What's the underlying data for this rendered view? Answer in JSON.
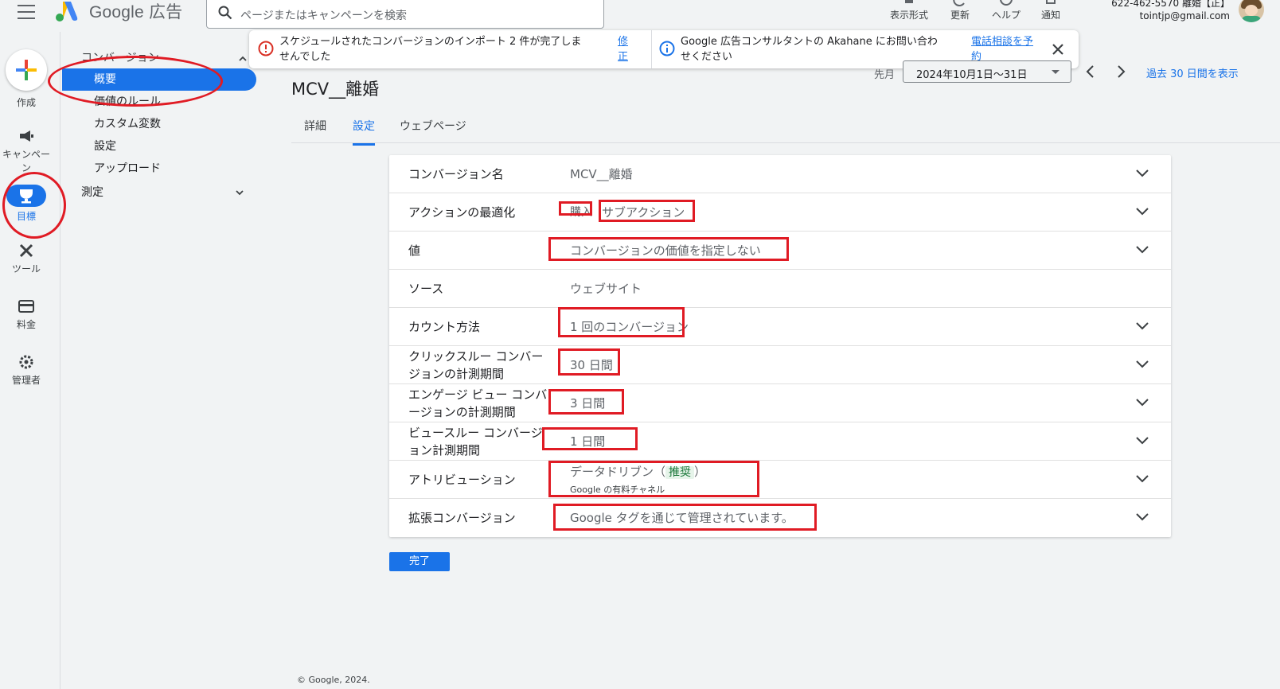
{
  "app": {
    "logo_text": "Google 広告",
    "search_placeholder": "ページまたはキャンペーンを検索"
  },
  "toolbar": [
    {
      "label": "表示形式",
      "icon": "appearance-icon"
    },
    {
      "label": "更新",
      "icon": "refresh-icon"
    },
    {
      "label": "ヘルプ",
      "icon": "help-icon"
    },
    {
      "label": "通知",
      "icon": "bell-icon"
    }
  ],
  "account": {
    "line1": "622-462-5570 離婚【正】",
    "line2": "tointjp@gmail.com"
  },
  "rail": {
    "create": "作成",
    "campaigns": "キャンペーン",
    "goals": "目標",
    "tools": "ツール",
    "billing": "料金",
    "admin": "管理者"
  },
  "subnav": {
    "section": "コンバージョン",
    "items": [
      "概要",
      "価値のルール",
      "カスタム変数",
      "設定",
      "アップロード"
    ],
    "measure": "測定"
  },
  "notices": {
    "left_text_1": "スケジュールされたコンバージョンのインポート 2 件が完了しま",
    "left_text_2": "せんでした",
    "left_link_1": "修",
    "left_link_2": "正",
    "right_text_1": "Google 広告コンサルタントの Akahane にお問い合わ",
    "right_text_2": "せください",
    "right_link_1": "電話相談を予",
    "right_link_2": "約"
  },
  "header": {
    "title": "MCV__離婚",
    "date_label": "先月",
    "date_range": "2024年10月1日～31日",
    "show_30": "過去 30 日間を表示"
  },
  "tabs": [
    "詳細",
    "設定",
    "ウェブページ"
  ],
  "settings": {
    "rows": [
      {
        "label": "コンバージョン名",
        "value": "MCV__離婚"
      },
      {
        "label": "アクションの最適化",
        "value_a": "購入",
        "value_b": "サブアクション"
      },
      {
        "label": "値",
        "value": "コンバージョンの価値を指定しない"
      },
      {
        "label": "ソース",
        "value": "ウェブサイト"
      },
      {
        "label": "カウント方法",
        "value": "1 回のコンバージョン"
      },
      {
        "label_1": "クリックスルー コンバー",
        "label_2": "ジョンの計測期間",
        "value": "30 日間"
      },
      {
        "label_1": "エンゲージ ビュー コンバ",
        "label_2": "ージョンの計測期間",
        "value": "3 日間"
      },
      {
        "label_1": "ビュースルー コンバージ",
        "label_2": "ョン計測期間",
        "value": "1 日間"
      },
      {
        "label": "アトリビューション",
        "value": "データドリブン（",
        "tag": "推奨",
        "value_end": "）",
        "sub": "Google の有料チャネル"
      },
      {
        "label": "拡張コンバージョン",
        "value": "Google タグを通じて管理されています。"
      }
    ]
  },
  "done_button": "完了",
  "footer": "© Google, 2024.",
  "colors": {
    "accent": "#1a73e8",
    "annotation": "#e01b24"
  }
}
